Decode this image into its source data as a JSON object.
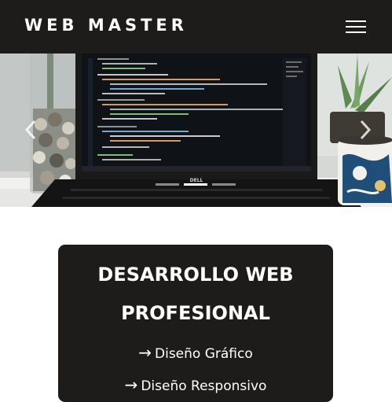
{
  "header": {
    "brand": "WEB MASTER",
    "menu_icon": "hamburger-menu-icon",
    "background": "#1e1c1b"
  },
  "carousel": {
    "slide_count": 3,
    "active_slide": 2,
    "prev_icon": "chevron-left-icon",
    "next_icon": "chevron-right-icon",
    "laptop_brand": "DELL"
  },
  "card": {
    "title_line1": "DESARROLLO WEB",
    "title_line2": "PROFESIONAL",
    "services": [
      {
        "arrow": "→",
        "label": "Diseño Gráfico"
      },
      {
        "arrow": "→",
        "label": "Diseño Responsivo"
      }
    ],
    "background": "#1e1c1b"
  }
}
